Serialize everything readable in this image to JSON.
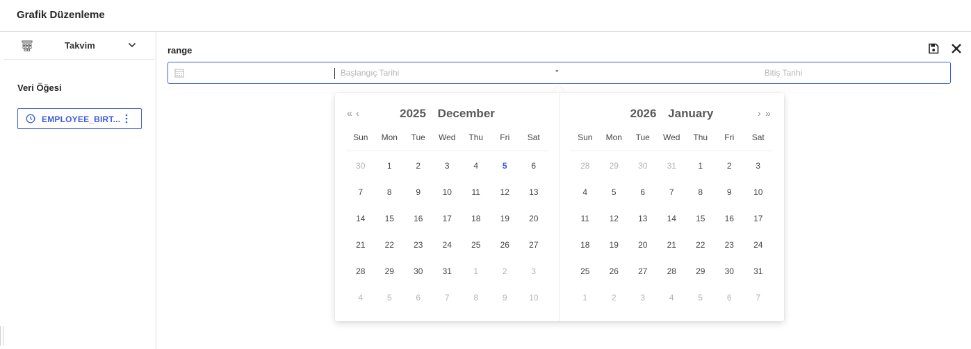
{
  "app": {
    "title": "Grafik Düzenleme"
  },
  "sidebar": {
    "chart_type": {
      "label": "Takvim",
      "icon": "calendar-grid-icon"
    },
    "section_title": "Veri Öğesi",
    "data_item": {
      "label": "EMPLOYEE_BIRT...",
      "icon": "clock-icon"
    }
  },
  "main": {
    "label": "range",
    "actions": {
      "save_icon": "save-icon",
      "close_icon": "close-icon"
    },
    "range": {
      "start_placeholder": "Başlangıç Tarihi",
      "separator": "-",
      "end_placeholder": "Bitiş Tarihi"
    }
  },
  "calendar": {
    "weekdays": [
      "Sun",
      "Mon",
      "Tue",
      "Wed",
      "Thu",
      "Fri",
      "Sat"
    ],
    "nav": {
      "prev_year": "«",
      "prev_month": "‹",
      "next_month": "›",
      "next_year": "»"
    },
    "left": {
      "year": "2025",
      "month": "December",
      "weeks": [
        [
          {
            "d": "30",
            "o": true
          },
          {
            "d": "1"
          },
          {
            "d": "2"
          },
          {
            "d": "3"
          },
          {
            "d": "4"
          },
          {
            "d": "5",
            "t": true
          },
          {
            "d": "6"
          }
        ],
        [
          {
            "d": "7"
          },
          {
            "d": "8"
          },
          {
            "d": "9"
          },
          {
            "d": "10"
          },
          {
            "d": "11"
          },
          {
            "d": "12"
          },
          {
            "d": "13"
          }
        ],
        [
          {
            "d": "14"
          },
          {
            "d": "15"
          },
          {
            "d": "16"
          },
          {
            "d": "17"
          },
          {
            "d": "18"
          },
          {
            "d": "19"
          },
          {
            "d": "20"
          }
        ],
        [
          {
            "d": "21"
          },
          {
            "d": "22"
          },
          {
            "d": "23"
          },
          {
            "d": "24"
          },
          {
            "d": "25"
          },
          {
            "d": "26"
          },
          {
            "d": "27"
          }
        ],
        [
          {
            "d": "28"
          },
          {
            "d": "29"
          },
          {
            "d": "30"
          },
          {
            "d": "31"
          },
          {
            "d": "1",
            "o": true
          },
          {
            "d": "2",
            "o": true
          },
          {
            "d": "3",
            "o": true
          }
        ],
        [
          {
            "d": "4",
            "o": true
          },
          {
            "d": "5",
            "o": true
          },
          {
            "d": "6",
            "o": true
          },
          {
            "d": "7",
            "o": true
          },
          {
            "d": "8",
            "o": true
          },
          {
            "d": "9",
            "o": true
          },
          {
            "d": "10",
            "o": true
          }
        ]
      ]
    },
    "right": {
      "year": "2026",
      "month": "January",
      "weeks": [
        [
          {
            "d": "28",
            "o": true
          },
          {
            "d": "29",
            "o": true
          },
          {
            "d": "30",
            "o": true
          },
          {
            "d": "31",
            "o": true
          },
          {
            "d": "1"
          },
          {
            "d": "2"
          },
          {
            "d": "3"
          }
        ],
        [
          {
            "d": "4"
          },
          {
            "d": "5"
          },
          {
            "d": "6"
          },
          {
            "d": "7"
          },
          {
            "d": "8"
          },
          {
            "d": "9"
          },
          {
            "d": "10"
          }
        ],
        [
          {
            "d": "11"
          },
          {
            "d": "12"
          },
          {
            "d": "13"
          },
          {
            "d": "14"
          },
          {
            "d": "15"
          },
          {
            "d": "16"
          },
          {
            "d": "17"
          }
        ],
        [
          {
            "d": "18"
          },
          {
            "d": "19"
          },
          {
            "d": "20"
          },
          {
            "d": "21"
          },
          {
            "d": "22"
          },
          {
            "d": "23"
          },
          {
            "d": "24"
          }
        ],
        [
          {
            "d": "25"
          },
          {
            "d": "26"
          },
          {
            "d": "27"
          },
          {
            "d": "28"
          },
          {
            "d": "29"
          },
          {
            "d": "30"
          },
          {
            "d": "31"
          }
        ],
        [
          {
            "d": "1",
            "o": true
          },
          {
            "d": "2",
            "o": true
          },
          {
            "d": "3",
            "o": true
          },
          {
            "d": "4",
            "o": true
          },
          {
            "d": "5",
            "o": true
          },
          {
            "d": "6",
            "o": true
          },
          {
            "d": "7",
            "o": true
          }
        ]
      ]
    }
  },
  "colors": {
    "accent": "#3b5bdb",
    "muted_day": "#b4b4b4",
    "border": "#dcdcdc"
  }
}
